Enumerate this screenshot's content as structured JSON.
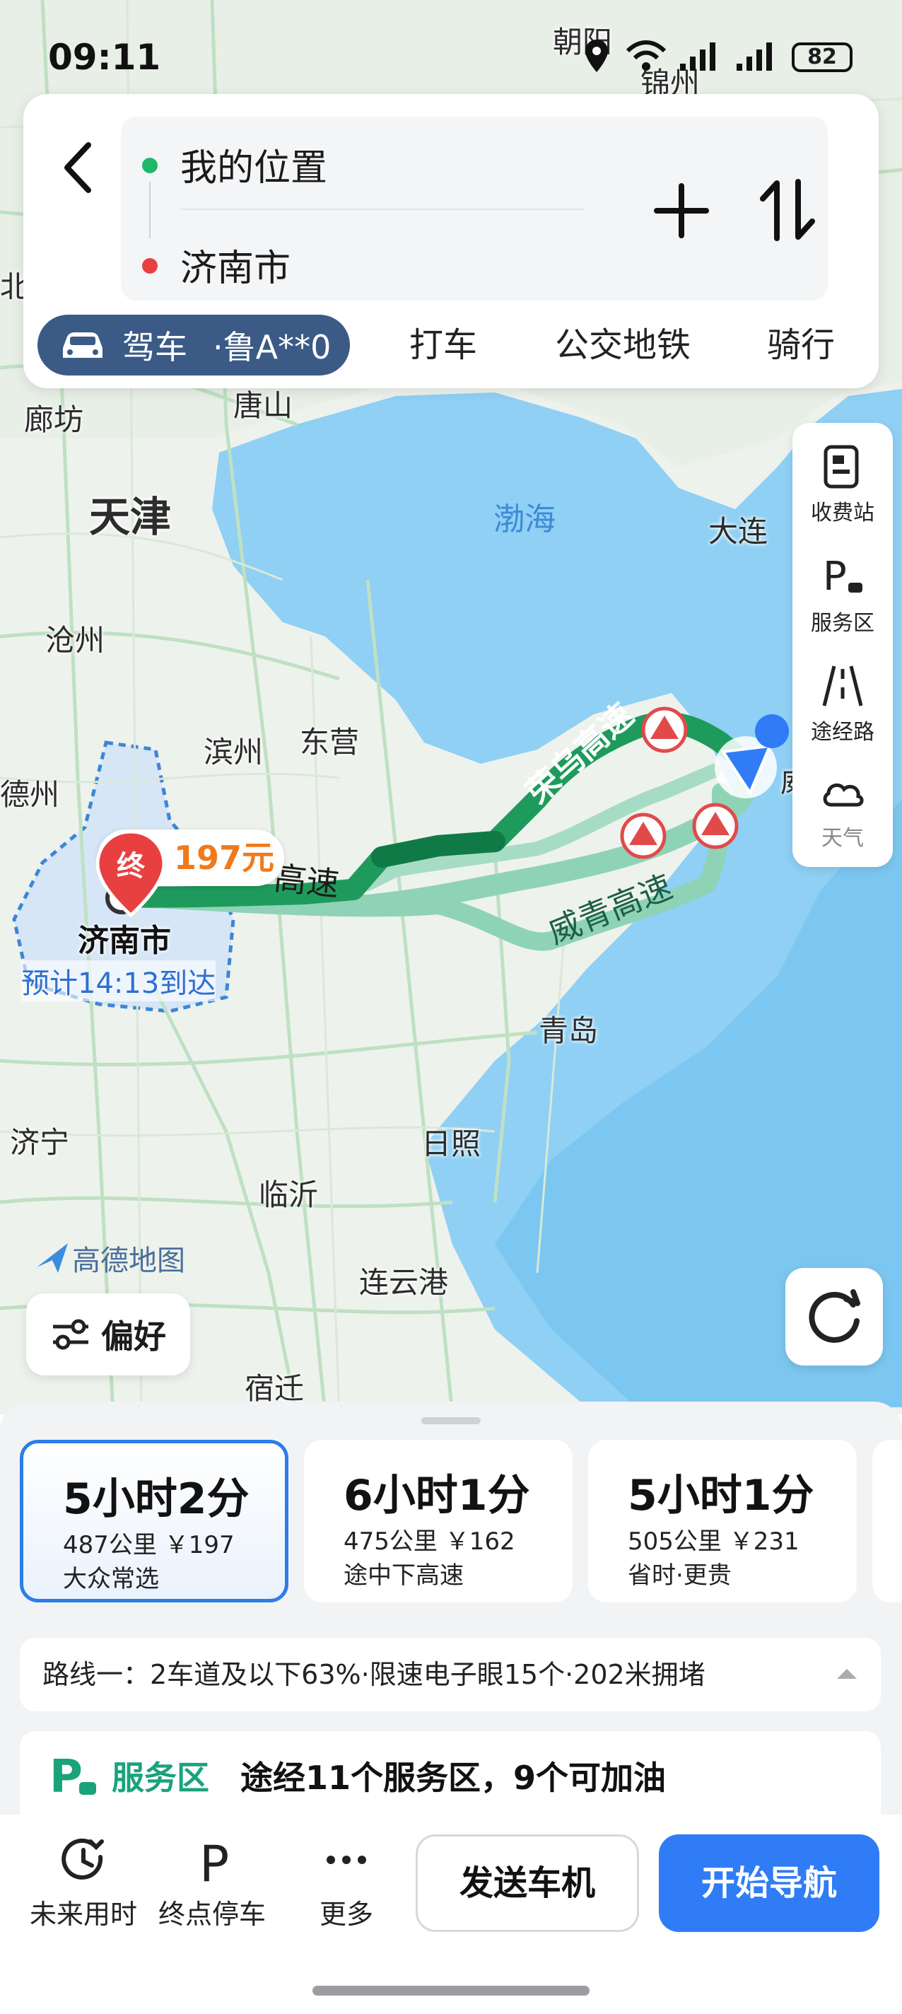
{
  "status_bar": {
    "time": "09:11",
    "battery": "82"
  },
  "search": {
    "origin": "我的位置",
    "destination": "济南市"
  },
  "modes": {
    "drive_label": "驾车",
    "plate": "·鲁A**0",
    "taxi": "打车",
    "transit": "公交地铁",
    "bike": "骑行"
  },
  "side_tools": [
    {
      "label": "收费站",
      "icon": "toll-station-icon"
    },
    {
      "label": "服务区",
      "icon": "service-area-icon"
    },
    {
      "label": "途经路",
      "icon": "via-road-icon"
    },
    {
      "label": "天气",
      "icon": "weather-icon"
    }
  ],
  "map": {
    "cities": [
      "朝阳",
      "锦州",
      "廊坊",
      "唐山",
      "天津",
      "大连",
      "沧州",
      "滨州",
      "东营",
      "德州",
      "青岛",
      "济宁",
      "日照",
      "临沂",
      "连云港",
      "宿迁",
      "北",
      "威"
    ],
    "sea": "渤海",
    "roads": [
      "荣乌高速",
      "高速",
      "威青高速"
    ],
    "destination": "济南市",
    "destination_marker": "终",
    "price": "197元",
    "eta": "预计14:13到达",
    "brand": "高德地图",
    "preference": "偏好"
  },
  "routes": [
    {
      "duration": "5小时2分",
      "meta": "487公里 ￥197",
      "tag": "大众常选",
      "selected": true
    },
    {
      "duration": "6小时1分",
      "meta": "475公里 ￥162",
      "tag": "途中下高速",
      "selected": false
    },
    {
      "duration": "5小时1分",
      "meta": "505公里 ￥231",
      "tag": "省时·更贵",
      "selected": false
    }
  ],
  "route_info": "路线一：2车道及以下63%·限速电子眼15个·202米拥堵",
  "service": {
    "label": "服务区",
    "text": "途经11个服务区，9个可加油"
  },
  "bottom": {
    "future": "未来用时",
    "parking": "终点停车",
    "more": "更多",
    "send": "发送车机",
    "navigate": "开始导航"
  },
  "colors": {
    "accent": "#2f7cf6",
    "route_main": "#1e9b5c",
    "route_alt": "#8fd3b6",
    "drive_tab": "#3b5a86",
    "price": "#f07a1b"
  }
}
